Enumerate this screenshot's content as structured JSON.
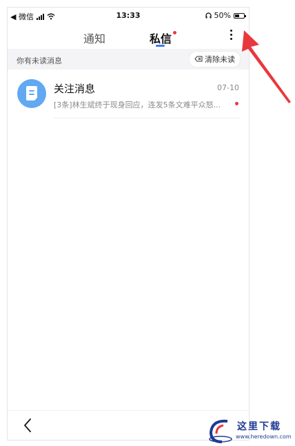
{
  "status_bar": {
    "carrier": "◀ 微信",
    "time": "13:33",
    "battery_percent": "50%",
    "battery_level": 0.5
  },
  "tabs": [
    {
      "label": "通知",
      "active": false
    },
    {
      "label": "私信",
      "active": true,
      "has_dot": true
    }
  ],
  "unread_bar": {
    "text": "你有未读消息",
    "clear_label": "清除未读"
  },
  "messages": [
    {
      "title": "关注消息",
      "date": "07-10",
      "preview": "[3条]林生斌终于现身回应，连发5条文难平众怒...",
      "unread": true
    }
  ],
  "colors": {
    "accent": "#3b7cf6",
    "unread_dot": "#e8383d",
    "avatar_bg": "#61a9f1",
    "annotation_arrow": "#e8383d"
  },
  "watermark": {
    "text": "这里下载",
    "url": "www.heredown.com"
  }
}
